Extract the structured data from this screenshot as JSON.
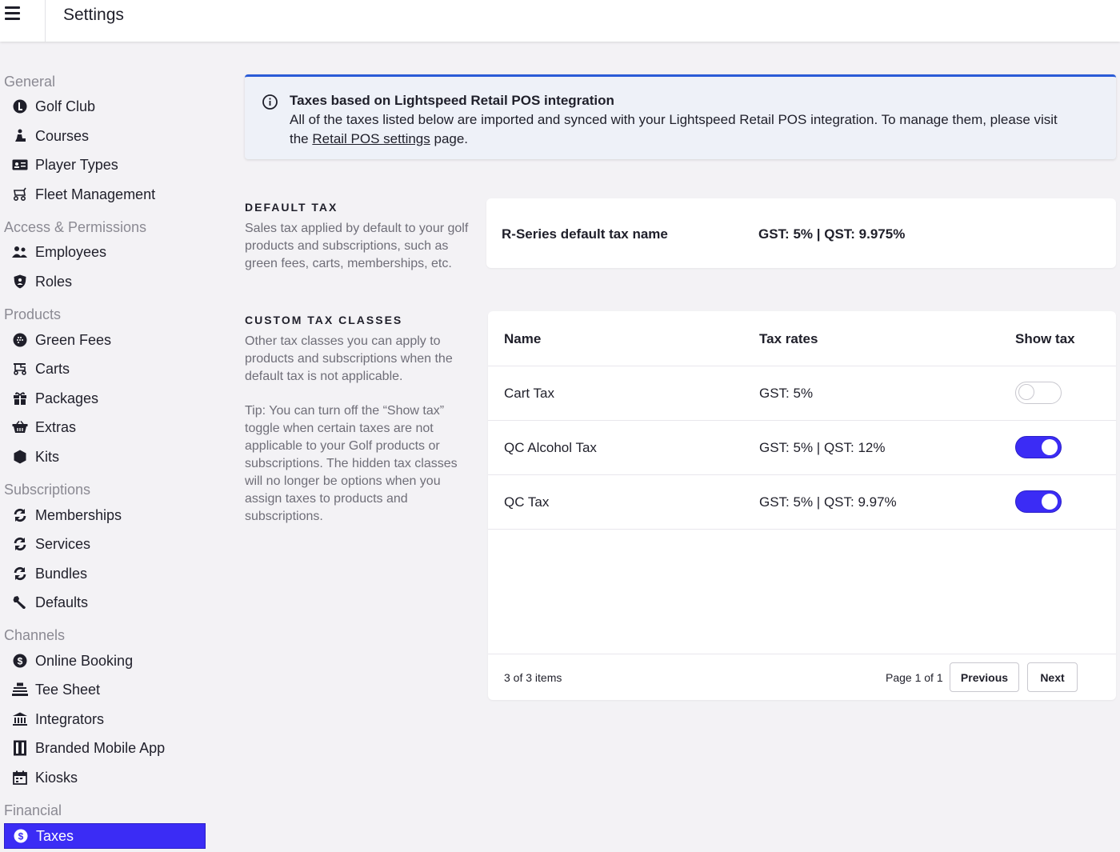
{
  "header": {
    "title": "Settings",
    "menu_icon": "hamburger-icon"
  },
  "sidebar": {
    "sections": [
      {
        "label": "General",
        "items": [
          {
            "label": "Golf Club",
            "icon": "golf-club-icon"
          },
          {
            "label": "Courses",
            "icon": "golfer-icon"
          },
          {
            "label": "Player Types",
            "icon": "id-card-icon"
          },
          {
            "label": "Fleet Management",
            "icon": "fleet-icon"
          }
        ]
      },
      {
        "label": "Access & Permissions",
        "items": [
          {
            "label": "Employees",
            "icon": "users-icon"
          },
          {
            "label": "Roles",
            "icon": "shield-icon"
          }
        ]
      },
      {
        "label": "Products",
        "items": [
          {
            "label": "Green Fees",
            "icon": "golf-ball-icon"
          },
          {
            "label": "Carts",
            "icon": "cart-icon"
          },
          {
            "label": "Packages",
            "icon": "gift-icon"
          },
          {
            "label": "Extras",
            "icon": "basket-icon"
          },
          {
            "label": "Kits",
            "icon": "cube-icon"
          }
        ]
      },
      {
        "label": "Subscriptions",
        "items": [
          {
            "label": "Memberships",
            "icon": "sync-icon"
          },
          {
            "label": "Services",
            "icon": "sync-icon"
          },
          {
            "label": "Bundles",
            "icon": "sync-icon"
          },
          {
            "label": "Defaults",
            "icon": "wrench-icon"
          }
        ]
      },
      {
        "label": "Channels",
        "items": [
          {
            "label": "Online Booking",
            "icon": "dollar-circle-icon"
          },
          {
            "label": "Tee Sheet",
            "icon": "tee-sheet-icon"
          },
          {
            "label": "Integrators",
            "icon": "bank-icon"
          },
          {
            "label": "Branded Mobile App",
            "icon": "mobile-app-icon"
          },
          {
            "label": "Kiosks",
            "icon": "calendar-icon"
          }
        ]
      },
      {
        "label": "Financial",
        "items": [
          {
            "label": "Taxes",
            "icon": "dollar-circle-icon",
            "active": true
          }
        ]
      }
    ]
  },
  "banner": {
    "icon": "info-icon",
    "title": "Taxes based on Lightspeed Retail POS integration",
    "body_line1": "All of the taxes listed below are imported and synced with your Lightspeed Retail POS integration. To manage them, please visit",
    "body_prefix": "the ",
    "link_text": "Retail POS settings",
    "body_suffix": " page.",
    "accent_color": "#2a5bd7"
  },
  "default_tax": {
    "heading": "DEFAULT TAX",
    "description": "Sales tax applied by default to your golf products and subscriptions, such as green fees, carts, memberships, etc.",
    "name_label": "R-Series default tax name",
    "value": "GST: 5% | QST: 9.975%"
  },
  "custom_tax": {
    "heading": "CUSTOM TAX CLASSES",
    "description": "Other tax classes you can apply to products and subscriptions when the default tax is not applicable.",
    "tip": "Tip: You can turn off the “Show tax” toggle when certain taxes are not applicable to your Golf products or subscriptions. The hidden tax classes will no longer be options when you assign taxes to products and subscriptions.",
    "columns": [
      "Name",
      "Tax rates",
      "Show tax"
    ],
    "rows": [
      {
        "name": "Cart Tax",
        "rates": "GST: 5%",
        "show_tax": false
      },
      {
        "name": "QC Alcohol Tax",
        "rates": "GST: 5% | QST: 12%",
        "show_tax": true
      },
      {
        "name": "QC Tax",
        "rates": "GST: 5% | QST: 9.97%",
        "show_tax": true
      }
    ],
    "footer": {
      "count": "3 of 3 items",
      "page": "Page 1 of 1",
      "previous": "Previous",
      "next": "Next"
    }
  },
  "colors": {
    "accent": "#3b2cf5",
    "background": "#f3f2f5"
  }
}
